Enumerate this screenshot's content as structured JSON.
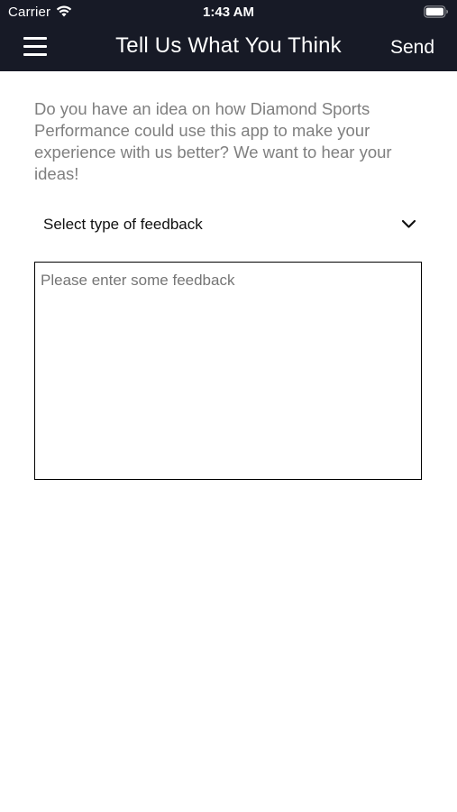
{
  "status_bar": {
    "carrier": "Carrier",
    "time": "1:43 AM",
    "wifi_icon": "wifi-icon",
    "battery_icon": "battery-icon"
  },
  "nav_bar": {
    "background_color": "#171a26",
    "menu_icon": "hamburger-menu-icon",
    "title": "Tell Us What You Think",
    "send_label": "Send"
  },
  "intro": {
    "text": "Do you have an idea on how Diamond Sports Performance could use this app to make your experience with us better? We want to hear your ideas!"
  },
  "feedback_type": {
    "selected": "Select type of feedback",
    "icon": "chevron-down-icon"
  },
  "feedback": {
    "placeholder": "Please enter some feedback",
    "value": ""
  }
}
